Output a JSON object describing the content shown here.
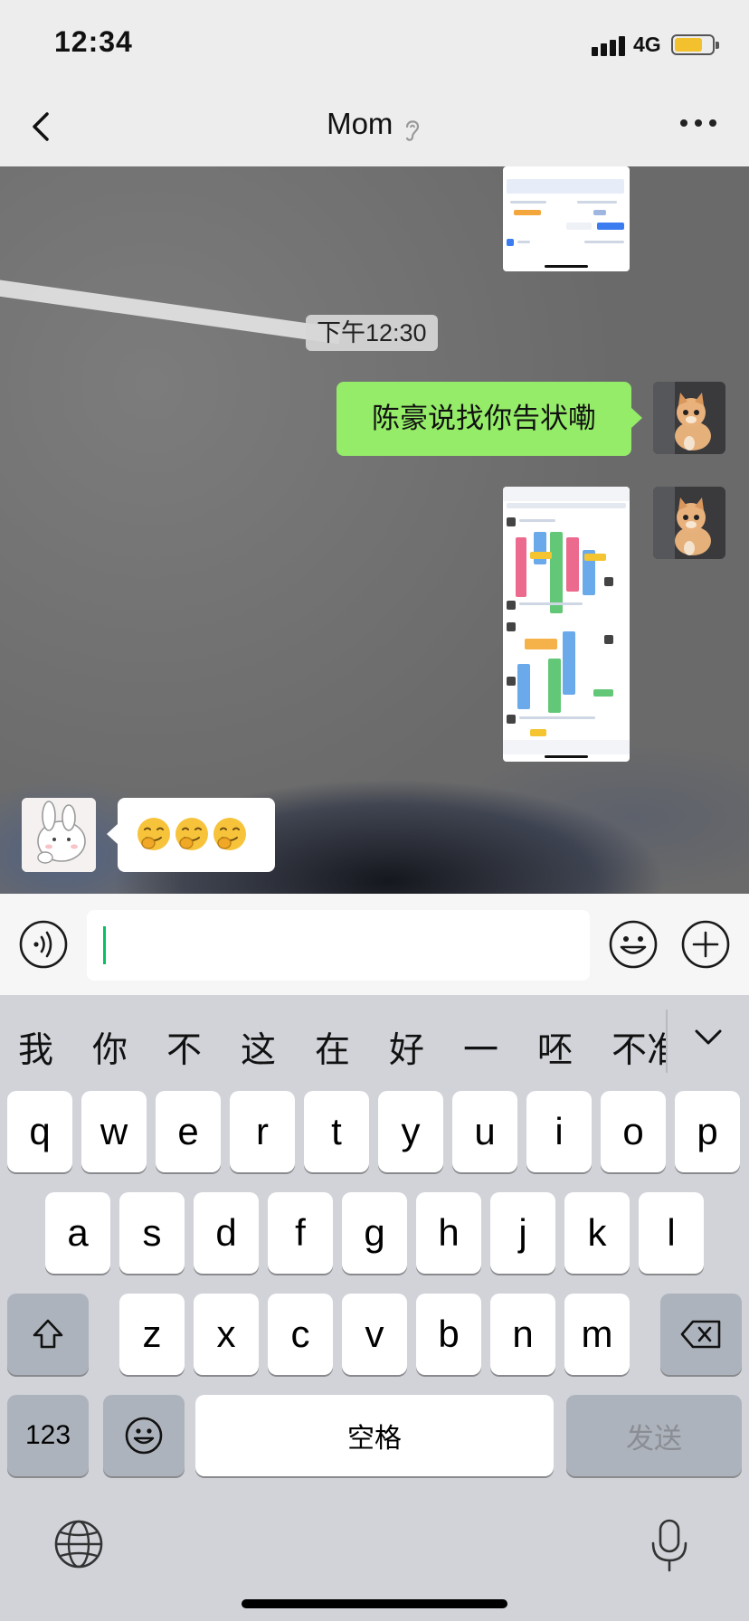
{
  "status_bar": {
    "time": "12:34",
    "network": "4G"
  },
  "header": {
    "title": "Mom"
  },
  "chat": {
    "timestamp": "下午12:30",
    "outgoing_text": "陈豪说找你告状嘞",
    "incoming_emoji": "🤭🤭🤭"
  },
  "input": {
    "value": ""
  },
  "keyboard": {
    "candidates": [
      "我",
      "你",
      "不",
      "这",
      "在",
      "好",
      "一",
      "呸",
      "不准"
    ],
    "row1": [
      "q",
      "w",
      "e",
      "r",
      "t",
      "y",
      "u",
      "i",
      "o",
      "p"
    ],
    "row2": [
      "a",
      "s",
      "d",
      "f",
      "g",
      "h",
      "j",
      "k",
      "l"
    ],
    "row3": [
      "z",
      "x",
      "c",
      "v",
      "b",
      "n",
      "m"
    ],
    "numbers_label": "123",
    "space_label": "空格",
    "send_label": "发送"
  },
  "colors": {
    "bubble_outgoing": "#95ec69",
    "cursor": "#07c160",
    "battery": "#f3c12d"
  },
  "icons": [
    "signal-icon",
    "battery-icon",
    "back-icon",
    "ear-icon",
    "more-icon",
    "voice-icon",
    "emoji-icon",
    "plus-icon",
    "chevron-down-icon",
    "shift-icon",
    "backspace-icon",
    "emoji-keyboard-icon",
    "globe-icon",
    "mic-icon"
  ]
}
